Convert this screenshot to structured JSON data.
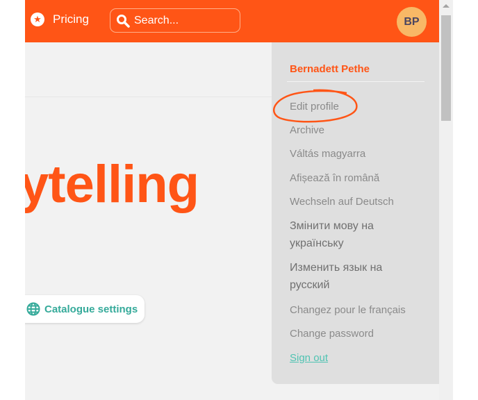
{
  "header": {
    "pricing_label": "Pricing",
    "pricing_icon": "star-icon",
    "search_placeholder": "Search...",
    "search_icon": "search-icon",
    "avatar_initials": "BP",
    "brand_color": "#ff5516"
  },
  "main": {
    "hero_text": "ytelling",
    "catalogue_button": "Catalogue settings",
    "catalogue_icon": "globe-icon"
  },
  "menu": {
    "user_name": "Bernadett Pethe",
    "items": [
      {
        "label": "Edit profile"
      },
      {
        "label": "Archive"
      },
      {
        "label": "Váltás magyarra"
      },
      {
        "label": "Afișează în română"
      },
      {
        "label": "Wechseln auf Deutsch"
      },
      {
        "label": "Змінити мову на українську"
      },
      {
        "label": "Изменить язык на русский"
      },
      {
        "label": "Changez pour le français"
      },
      {
        "label": "Change password"
      },
      {
        "label": "Sign out"
      }
    ]
  }
}
